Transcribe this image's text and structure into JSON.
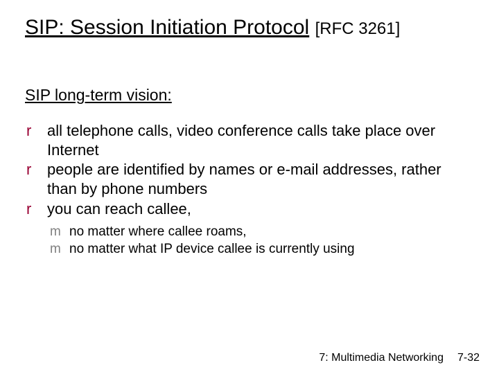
{
  "title": {
    "main": "SIP: Session Initiation Protocol",
    "note": "[RFC 3261]"
  },
  "section_heading": "SIP long-term vision:",
  "bullets_r": {
    "marker": "r",
    "items": [
      "all telephone calls, video conference calls take place over Internet",
      "people are identified by names or e-mail addresses, rather than by phone numbers",
      "you can reach callee,"
    ]
  },
  "bullets_m": {
    "marker": "m",
    "items": [
      "no matter where callee roams,",
      "no matter what IP device callee is currently using"
    ]
  },
  "footer": {
    "chapter": "7: Multimedia Networking",
    "page": "7-32"
  }
}
